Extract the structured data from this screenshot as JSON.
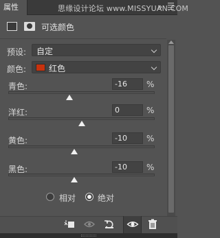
{
  "tab": {
    "label": "属性"
  },
  "watermark": "思缘设计论坛 www.MISSYUAN.COM",
  "header": {
    "title": "可选颜色"
  },
  "preset": {
    "label": "预设:",
    "value": "自定"
  },
  "colors": {
    "label": "颜色:",
    "value": "红色",
    "swatch": "#c8320d"
  },
  "sliders": [
    {
      "label": "青色:",
      "value": "-16",
      "unit": "%",
      "percent": -16
    },
    {
      "label": "洋红:",
      "value": "0",
      "unit": "%",
      "percent": 0
    },
    {
      "label": "黄色:",
      "value": "-10",
      "unit": "%",
      "percent": -10
    },
    {
      "label": "黑色:",
      "value": "-10",
      "unit": "%",
      "percent": -10
    }
  ],
  "method": {
    "options": [
      {
        "label": "相对",
        "checked": false
      },
      {
        "label": "绝对",
        "checked": true
      }
    ]
  },
  "toolbar": {
    "icons": [
      "clip-to-layer-icon",
      "view-previous-state-icon",
      "reset-icon",
      "toggle-visibility-icon",
      "delete-icon"
    ]
  }
}
